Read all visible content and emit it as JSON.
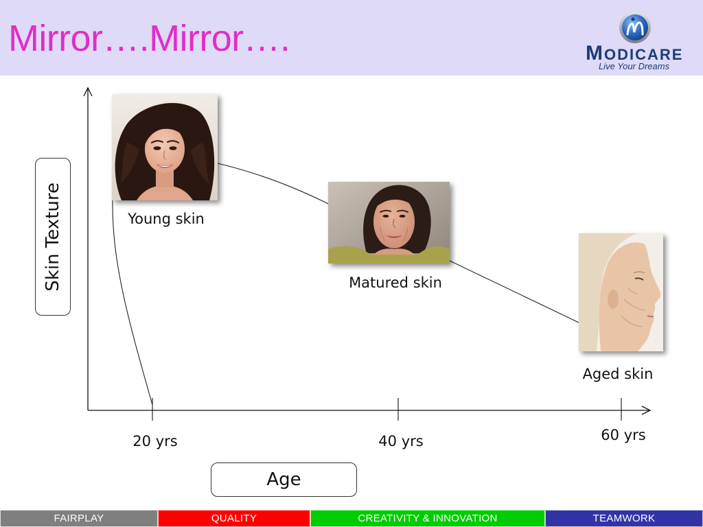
{
  "header": {
    "title": "Mirror….Mirror….",
    "title_color": "#E22DC7",
    "background": "#DEDAF7",
    "logo": {
      "icon": "modicare-globe-icon",
      "brand": "MODICARE",
      "tagline": "Live Your Dreams",
      "color": "#1E3A7A"
    }
  },
  "diagram": {
    "y_axis_label": "Skin Texture",
    "x_axis_label": "Age",
    "x_ticks": [
      "20 yrs",
      "40 yrs",
      "60 yrs"
    ],
    "stages": [
      "Young skin",
      "Matured skin",
      "Aged skin"
    ]
  },
  "footer": {
    "items": [
      {
        "label": "FAIRPLAY",
        "color": "#7F7F7F"
      },
      {
        "label": "QUALITY",
        "color": "#FF0000"
      },
      {
        "label": "CREATIVITY & INNOVATION",
        "color": "#00CC00"
      },
      {
        "label": "TEAMWORK",
        "color": "#3333A8"
      }
    ]
  }
}
